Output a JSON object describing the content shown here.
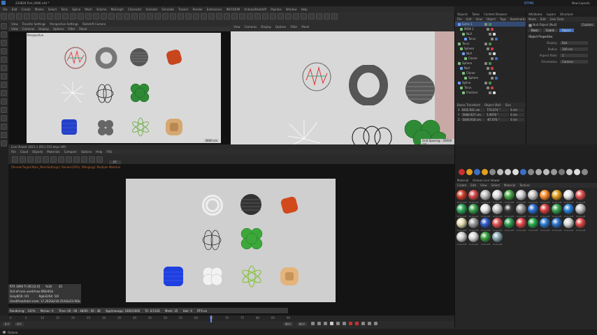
{
  "window": {
    "title": "220828 Test_0006.c4d *",
    "layout_label": "BTPMS",
    "new_layouts": "New Layouts"
  },
  "menu": [
    "File",
    "Edit",
    "Create",
    "Modes",
    "Select",
    "Tools",
    "Spline",
    "Mesh",
    "Volume",
    "MoGraph",
    "Character",
    "Animate",
    "Simulate",
    "Tracker",
    "Render",
    "Extensions",
    "INSYDIUM",
    "Octane/Redshift",
    "Pipeline",
    "Window",
    "Help"
  ],
  "viewport_left": {
    "tabs": [
      "View",
      "Transfer Settings",
      "Perspective Settings",
      "Redshift Camera"
    ],
    "menu": [
      "View",
      "Cameras",
      "Display",
      "Options",
      "Filter",
      "Panel"
    ],
    "label": "Perspective",
    "scale": "3000 cm"
  },
  "viewport_right": {
    "menu": [
      "View",
      "Cameras",
      "Display",
      "Options",
      "Filter",
      "Panel"
    ],
    "grid": "Grid Spacing : 50000 cm"
  },
  "live_viewer": {
    "title": "Live Viewer 2021.1 (R2) (153 days left)",
    "menu": [
      "File",
      "Cloud",
      "Objects",
      "Materials",
      "Compare",
      "Options",
      "Help",
      "FAQ"
    ],
    "render_target": "PT",
    "error_line": "[RenderTarget:Main_MeshSettings]: Render(GPU): [Merging]: Multiple Material",
    "stats": {
      "gpu": "RTX 3090 Ti (RC)[2.0]",
      "gpu_pct": "%18",
      "gpu_temp": "45",
      "out_of_core": "Out-of-core used/max:0Kb/4Gb",
      "grey": "Grey8/16: 0/1",
      "rgb": "Rgb32/64: 5/0",
      "vram": "Used/free/total vram: 17.202Gb/18.254Gb/23.9Gb",
      "rendering_label": "Rendering:",
      "rendering_pct": "100%",
      "msamples": "Ms/sec: 0",
      "time": "Time: 00 : 00 : 48/00 : 00 : 48",
      "spp": "Spp/maxspp: 1600/1600",
      "tri": "Tri: 0/1326",
      "mesh": "Mesh: 35",
      "hair": "Hair: 0",
      "rtx": "RTX:on"
    }
  },
  "objects_panel": {
    "tabs": [
      "Objects",
      "Takes",
      "Content Browser"
    ],
    "menu": [
      "File",
      "Edit",
      "View",
      "Object",
      "Tags",
      "Bookmarks"
    ],
    "rows": [
      "Extra 1",
      "MEW 1",
      "Null",
      "Torus",
      "Torus",
      "Sphere",
      "Null",
      "Cloner",
      "Sphere",
      "Null",
      "Cloner",
      "Sphere",
      "Spline",
      "Torus",
      "Fracture",
      "Background",
      "Floor",
      "Cloner",
      "Sphere",
      "Cloner"
    ],
    "coords_tabs": [
      "Boxes Transform",
      "Object (Rel)",
      "Size"
    ],
    "coords": [
      {
        "axis": "X",
        "pos": "3935.931 cm",
        "rot": "770.074 °",
        "size": "0 cm"
      },
      {
        "axis": "Y",
        "pos": "-5086.927 cm",
        "rot": "5.9976 °",
        "size": "0 cm"
      },
      {
        "axis": "Z",
        "pos": "-5406.918 cm",
        "rot": "-87.076 °",
        "size": "0 cm"
      }
    ]
  },
  "attributes_panel": {
    "tabs": [
      "Attributes",
      "Layers",
      "Structure"
    ],
    "menu": [
      "Mode",
      "Edit",
      "User Data"
    ],
    "object_name": "Null Object [Null]",
    "sub_tabs": [
      "Basic",
      "Coord.",
      "Object"
    ],
    "section": "Object Properties",
    "props": [
      {
        "label": "Display",
        "value": "Dot"
      },
      {
        "label": "Radius",
        "value": "100 cm"
      },
      {
        "label": "Aspect Ratio",
        "value": "1"
      },
      {
        "label": "Orientation",
        "value": "Camera"
      }
    ],
    "mode_dropdown": "Custom"
  },
  "material_panel": {
    "tabs": [
      "Material",
      "Octane Live Viewer"
    ],
    "menu": [
      "Create",
      "Edit",
      "View",
      "Select",
      "Material",
      "Texture"
    ],
    "materials": [
      {
        "name": "OctaneM",
        "color": "#d0402a"
      },
      {
        "name": "OctaneM",
        "color": "#d04a4a"
      },
      {
        "name": "OctaneM",
        "color": "#bfbfbf"
      },
      {
        "name": "OctaneM",
        "color": "#e0e0e0"
      },
      {
        "name": "OctaneM",
        "color": "#4aa848"
      },
      {
        "name": "OctaneM",
        "color": "#cfcfcf"
      },
      {
        "name": "OctaneM",
        "color": "#c8c8c8"
      },
      {
        "name": "OctaneM",
        "color": "#ff8a2a"
      },
      {
        "name": "OctaneM",
        "color": "#e0a020"
      },
      {
        "name": "OctaneM",
        "color": "#e8e8e8"
      },
      {
        "name": "OctaneM",
        "color": "#e05252"
      },
      {
        "name": "OctaneM",
        "color": "#2ea85a"
      },
      {
        "name": "OctaneM",
        "color": "#36a04a"
      },
      {
        "name": "OctaneM",
        "color": "#e8e8e8"
      },
      {
        "name": "OctaneM",
        "color": "#c8c8c8"
      },
      {
        "name": "OctaneM",
        "color": "#3a3a3a"
      },
      {
        "name": "OctaneM",
        "color": "#9a9a9a"
      },
      {
        "name": "OctaneM",
        "color": "#2a6fd0"
      },
      {
        "name": "OctaneM",
        "color": "#d84040"
      },
      {
        "name": "OctaneM",
        "color": "#38a050"
      },
      {
        "name": "OctaneM",
        "color": "#2a80d8"
      },
      {
        "name": "OctaneM",
        "color": "#c0c0c0"
      },
      {
        "name": "OctaneM",
        "color": "#e4dcb0"
      },
      {
        "name": "OctaneM",
        "color": "#9c9c9c"
      },
      {
        "name": "OctaneM",
        "color": "#3058c8"
      },
      {
        "name": "OctaneM",
        "color": "#e05050"
      },
      {
        "name": "OctaneM",
        "color": "#30a050"
      },
      {
        "name": "OctaneM",
        "color": "#e04848"
      },
      {
        "name": "OctaneM",
        "color": "#2aa850"
      },
      {
        "name": "OctaneM",
        "color": "#2c7ad0"
      },
      {
        "name": "OctaneM",
        "color": "#2a70c8"
      },
      {
        "name": "OctaneM",
        "color": "#d8d8d8"
      },
      {
        "name": "OctaneM",
        "color": "#e04848"
      },
      {
        "name": "OctaneM",
        "color": "#d0d0d0"
      },
      {
        "name": "OctaneM",
        "color": "#d8d8d8"
      },
      {
        "name": "OctaneM",
        "color": "#3aa040"
      },
      {
        "name": "OctaneM",
        "color": "#8aa8b0"
      }
    ]
  },
  "timeline": {
    "start": "0 F",
    "current": "0 F",
    "end": "90 F",
    "end2": "90 F",
    "ticks": [
      "0",
      "5",
      "10",
      "15",
      "20",
      "25",
      "30",
      "35",
      "40",
      "45",
      "50",
      "55",
      "60",
      "65",
      "70",
      "75",
      "80",
      "85",
      "90"
    ]
  },
  "status": "Octane"
}
